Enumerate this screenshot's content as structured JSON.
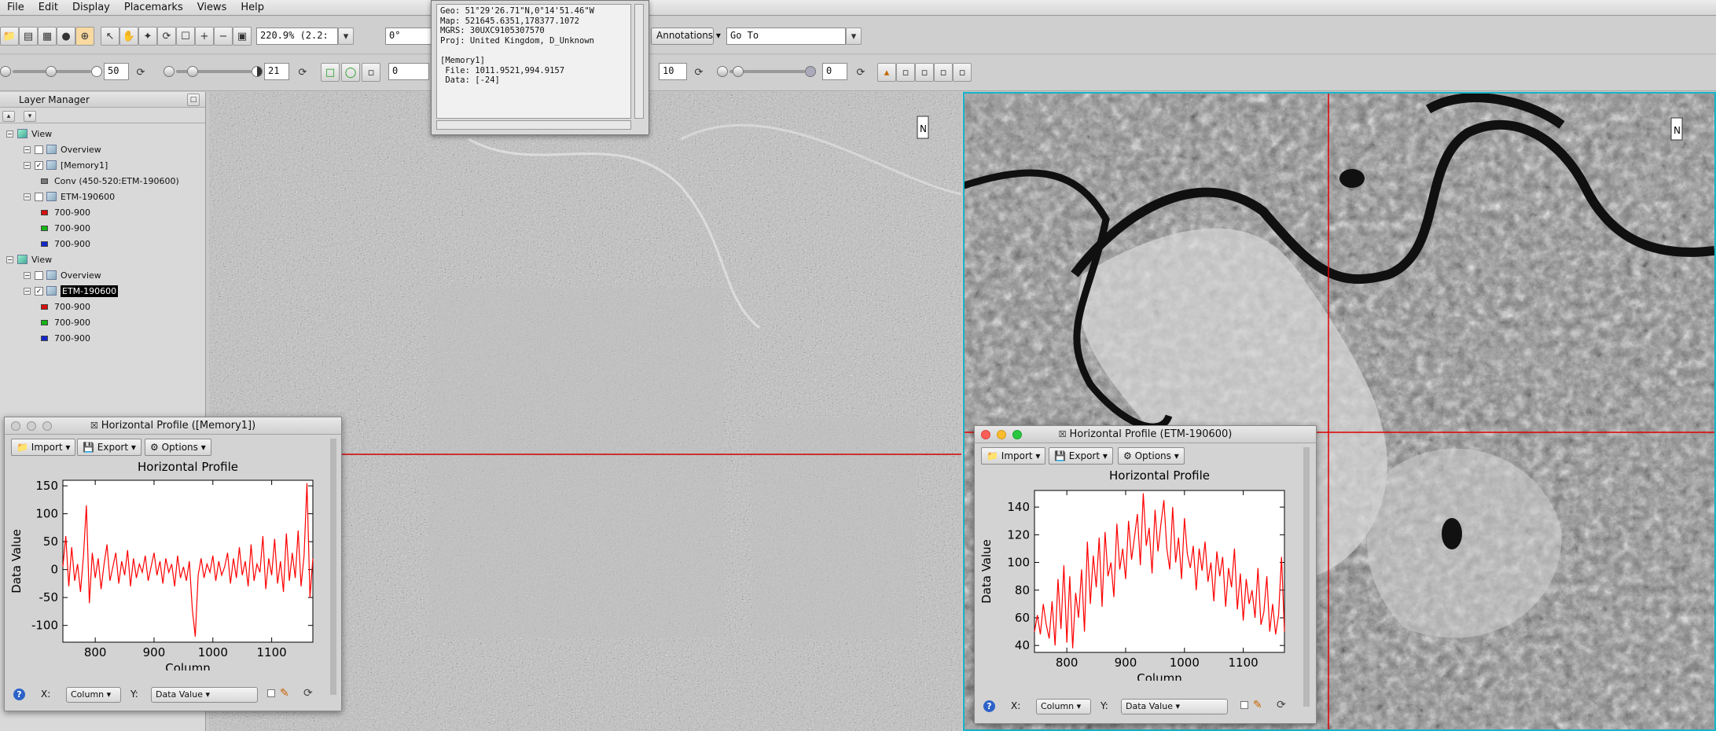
{
  "menubar": {
    "items": [
      "File",
      "Edit",
      "Display",
      "Placemarks",
      "Views",
      "Help"
    ]
  },
  "toolbar": {
    "zoom_value": "220.9% (2.2:",
    "rotation_value": "0°",
    "annotations_label": "Annotations",
    "goto_value": "Go To",
    "brightness_value": "50",
    "contrast_value": "21",
    "stretch_value": "0",
    "sharpen_value": "10",
    "transparency_value": "0"
  },
  "info_popup": {
    "lines": [
      "Geo: 51°29'26.71\"N,0°14'51.46\"W",
      "Map: 521645.6351,178377.1072",
      "MGRS: 30UXC9105307570",
      "Proj: United Kingdom, D_Unknown",
      "",
      "[Memory1]",
      " File: 1011.9521,994.9157",
      " Data: [-24]"
    ]
  },
  "layer_manager": {
    "title": "Layer Manager",
    "tree": [
      {
        "label": "View",
        "indent": 0,
        "kind": "view"
      },
      {
        "label": "Overview",
        "indent": 1,
        "kind": "layer",
        "checked": false
      },
      {
        "label": "[Memory1]",
        "indent": 1,
        "kind": "layer",
        "checked": true
      },
      {
        "label": "Conv (450-520:ETM-190600)",
        "indent": 2,
        "kind": "band"
      },
      {
        "label": "ETM-190600",
        "indent": 1,
        "kind": "layer",
        "checked": false
      },
      {
        "label": "700-900",
        "indent": 2,
        "kind": "red"
      },
      {
        "label": "700-900",
        "indent": 2,
        "kind": "green"
      },
      {
        "label": "700-900",
        "indent": 2,
        "kind": "blue"
      },
      {
        "label": "View",
        "indent": 0,
        "kind": "view"
      },
      {
        "label": "Overview",
        "indent": 1,
        "kind": "layer",
        "checked": false
      },
      {
        "label": "ETM-190600",
        "indent": 1,
        "kind": "layer",
        "checked": true,
        "selected": true
      },
      {
        "label": "700-900",
        "indent": 2,
        "kind": "red"
      },
      {
        "label": "700-900",
        "indent": 2,
        "kind": "green"
      },
      {
        "label": "700-900",
        "indent": 2,
        "kind": "blue"
      }
    ]
  },
  "profile_left": {
    "title": "Horizontal Profile ([Memory1])",
    "import_label": "Import",
    "export_label": "Export",
    "options_label": "Options",
    "x_label": "X:",
    "y_label": "Y:",
    "x_select": "Column",
    "y_select": "Data Value"
  },
  "profile_right": {
    "title": "Horizontal Profile (ETM-190600)",
    "import_label": "Import",
    "export_label": "Export",
    "options_label": "Options",
    "x_label": "X:",
    "y_label": "Y:",
    "x_select": "Column",
    "y_select": "Data Value"
  },
  "chart_data": [
    {
      "type": "line",
      "title": "Horizontal Profile",
      "xlabel": "Column",
      "ylabel": "Data Value",
      "xlim": [
        745,
        1170
      ],
      "ylim": [
        -130,
        160
      ],
      "xticks": [
        800,
        900,
        1000,
        1100
      ],
      "xtick_labels": [
        "800",
        "900",
        "1000",
        "1100"
      ],
      "yticks": [
        150,
        100,
        50,
        0,
        -50,
        -100
      ],
      "ytick_labels": [
        "150",
        "100",
        "50",
        "0",
        "-50",
        "-100"
      ],
      "color": "#ff0000",
      "series": [
        {
          "x": [
            745,
            750,
            755,
            760,
            765,
            770,
            775,
            780,
            785,
            790,
            795,
            800,
            805,
            810,
            815,
            820,
            825,
            830,
            835,
            840,
            845,
            850,
            855,
            860,
            865,
            870,
            875,
            880,
            885,
            890,
            895,
            900,
            905,
            910,
            915,
            920,
            925,
            930,
            935,
            940,
            945,
            950,
            955,
            960,
            965,
            970,
            975,
            980,
            985,
            990,
            995,
            1000,
            1005,
            1010,
            1015,
            1020,
            1025,
            1030,
            1035,
            1040,
            1045,
            1050,
            1055,
            1060,
            1065,
            1070,
            1075,
            1080,
            1085,
            1090,
            1095,
            1100,
            1105,
            1110,
            1115,
            1120,
            1125,
            1130,
            1135,
            1140,
            1145,
            1150,
            1155,
            1160,
            1165,
            1170
          ],
          "y": [
            5,
            60,
            -30,
            40,
            -20,
            10,
            -40,
            25,
            115,
            -60,
            30,
            -15,
            20,
            -35,
            10,
            45,
            -20,
            5,
            30,
            -25,
            15,
            -10,
            35,
            -30,
            20,
            -15,
            10,
            -5,
            25,
            -20,
            5,
            30,
            -10,
            15,
            -25,
            20,
            -5,
            10,
            -30,
            25,
            -15,
            5,
            -20,
            15,
            -70,
            -120,
            -10,
            20,
            -15,
            10,
            -5,
            25,
            -20,
            15,
            -10,
            5,
            30,
            -25,
            20,
            -15,
            40,
            -10,
            15,
            -30,
            45,
            -20,
            10,
            -5,
            60,
            -35,
            20,
            -10,
            55,
            -25,
            15,
            -40,
            65,
            -20,
            30,
            -15,
            70,
            -30,
            25,
            155,
            -50,
            20
          ]
        }
      ]
    },
    {
      "type": "line",
      "title": "Horizontal Profile",
      "xlabel": "Column",
      "ylabel": "Data Value",
      "xlim": [
        745,
        1170
      ],
      "ylim": [
        35,
        152
      ],
      "xticks": [
        800,
        900,
        1000,
        1100
      ],
      "xtick_labels": [
        "800",
        "900",
        "1000",
        "1100"
      ],
      "yticks": [
        140,
        120,
        100,
        80,
        60,
        40
      ],
      "ytick_labels": [
        "140",
        "120",
        "100",
        "80",
        "60",
        "40"
      ],
      "color": "#ff0000",
      "series": [
        {
          "x": [
            745,
            750,
            755,
            760,
            765,
            770,
            775,
            780,
            785,
            790,
            795,
            800,
            805,
            810,
            815,
            820,
            825,
            830,
            835,
            840,
            845,
            850,
            855,
            860,
            865,
            870,
            875,
            880,
            885,
            890,
            895,
            900,
            905,
            910,
            915,
            920,
            925,
            930,
            935,
            940,
            945,
            950,
            955,
            960,
            965,
            970,
            975,
            980,
            985,
            990,
            995,
            1000,
            1005,
            1010,
            1015,
            1020,
            1025,
            1030,
            1035,
            1040,
            1045,
            1050,
            1055,
            1060,
            1065,
            1070,
            1075,
            1080,
            1085,
            1090,
            1095,
            1100,
            1105,
            1110,
            1115,
            1120,
            1125,
            1130,
            1135,
            1140,
            1145,
            1150,
            1155,
            1160,
            1165,
            1170
          ],
          "y": [
            50,
            62,
            48,
            70,
            55,
            45,
            72,
            40,
            88,
            52,
            98,
            42,
            90,
            38,
            78,
            60,
            95,
            50,
            115,
            70,
            105,
            82,
            118,
            68,
            122,
            90,
            100,
            75,
            128,
            95,
            110,
            88,
            130,
            102,
            118,
            135,
            98,
            150,
            112,
            125,
            92,
            138,
            108,
            128,
            145,
            110,
            95,
            140,
            100,
            118,
            88,
            132,
            106,
            96,
            112,
            80,
            110,
            94,
            115,
            86,
            100,
            72,
            108,
            90,
            104,
            68,
            96,
            82,
            110,
            66,
            92,
            58,
            88,
            70,
            80,
            60,
            96,
            55,
            64,
            90,
            50,
            70,
            48,
            62,
            104,
            50
          ]
        }
      ]
    }
  ]
}
